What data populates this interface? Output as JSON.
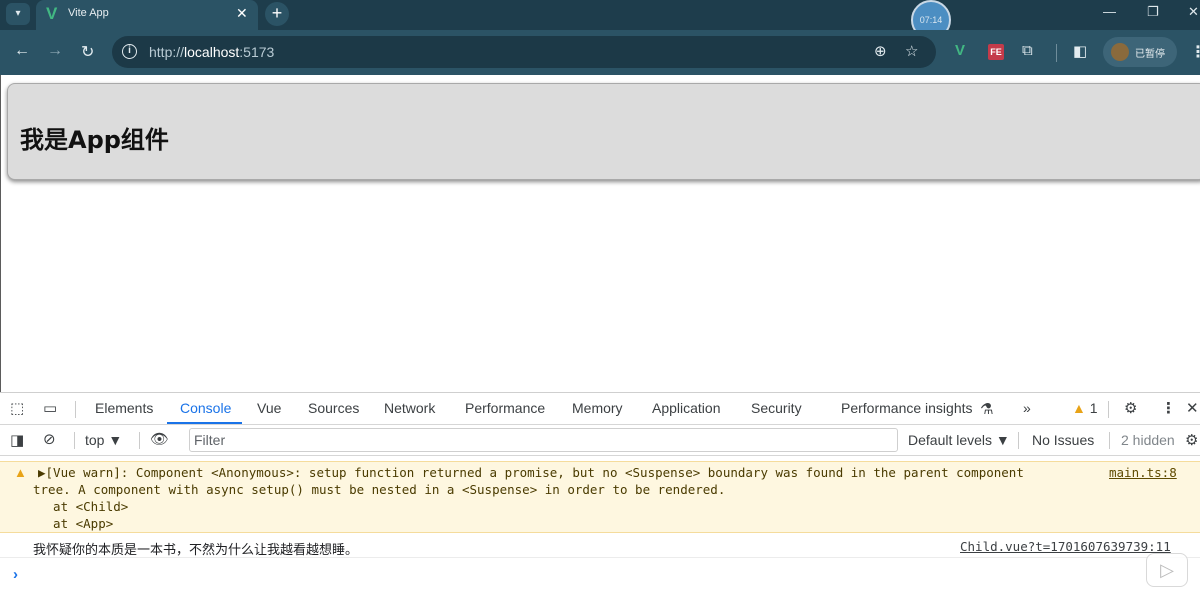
{
  "browser": {
    "tab": {
      "favicon": "V",
      "title": "Vite App",
      "close": "✕"
    },
    "new_tab": "+",
    "overlay_clock": "07:14",
    "window_controls": {
      "minimize": "—",
      "restore": "❐",
      "close": "✕"
    },
    "address": {
      "scheme": "http://",
      "host": "localhost",
      "port": ":5173"
    },
    "profile_label": "已暂停",
    "icons": [
      "back-arrow-icon",
      "forward-arrow-icon",
      "reload-icon",
      "info-icon",
      "zoom-icon",
      "star-icon",
      "vue-devtools-icon",
      "fe-extension-icon",
      "extensions-puzzle-icon",
      "side-panel-icon",
      "kebab-menu-icon"
    ]
  },
  "page": {
    "heading": "我是App组件"
  },
  "devtools": {
    "tabs": [
      "Elements",
      "Console",
      "Vue",
      "Sources",
      "Network",
      "Performance",
      "Memory",
      "Application",
      "Security",
      "Performance insights"
    ],
    "active_tab": "Console",
    "more_tabs": "»",
    "warning_count": "1",
    "filter": {
      "context": "top",
      "placeholder": "Filter",
      "levels": "Default levels",
      "issues": "No Issues",
      "hidden": "2 hidden"
    },
    "warning_message": {
      "lines": [
        "▶[Vue warn]: Component <Anonymous>: setup function returned a promise, but no <Suspense> boundary was found in the parent component",
        "tree. A component with async setup() must be nested in a <Suspense> in order to be rendered.",
        "  at <Child>",
        "  at <App>"
      ],
      "source": "main.ts:8"
    },
    "log_message": {
      "text": "我怀疑你的本质是一本书，不然为什么让我越看越想睡。",
      "source": "Child.vue?t=1701607639739:11"
    },
    "prompt": "›",
    "accent_color": "#1a73e8",
    "warning_color": "#e8a317"
  }
}
